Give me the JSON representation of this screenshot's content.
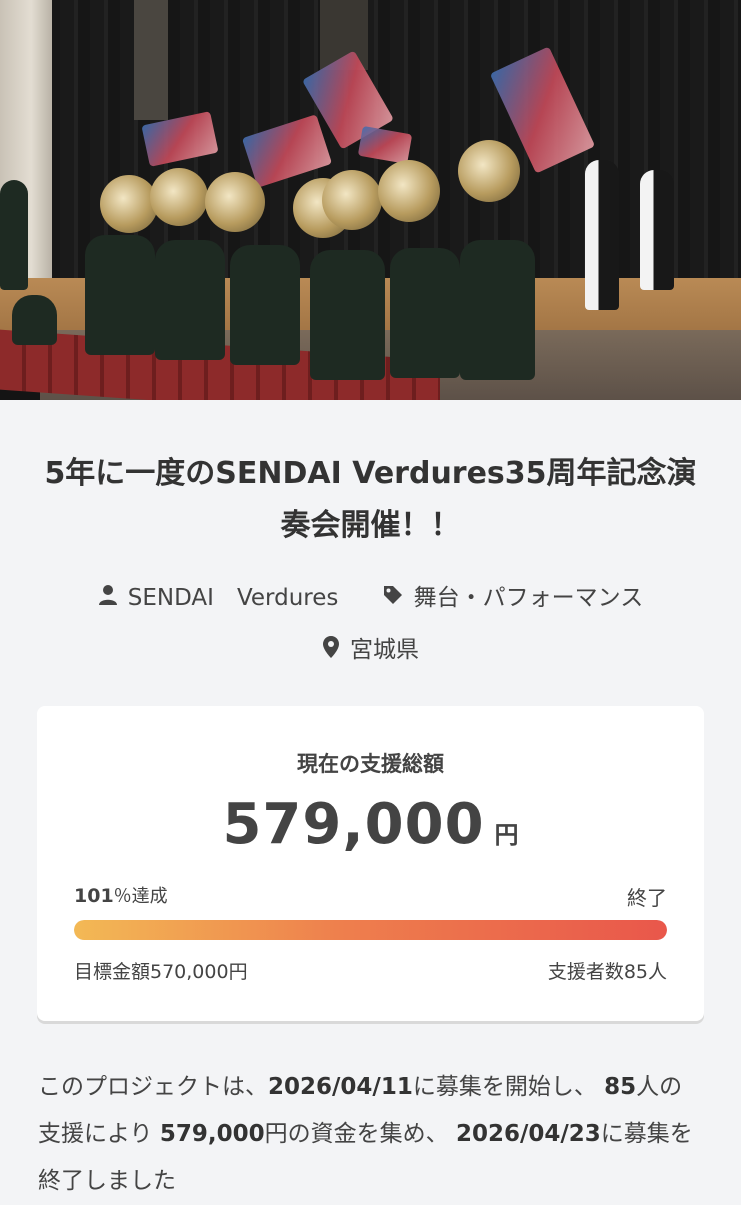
{
  "project": {
    "title": "5年に一度のSENDAI Verdures35周年記念演奏会開催！！",
    "owner": "SENDAI　Verdures",
    "category": "舞台・パフォーマンス",
    "location": "宮城県",
    "icons": {
      "owner": "person-icon",
      "category": "tag-icon",
      "location": "location-pin-icon"
    }
  },
  "support": {
    "label": "現在の支援総額",
    "amount": "579,000",
    "currency": "円",
    "rate_value": "101",
    "rate_suffix": "％達成",
    "status": "終了",
    "progress_percent": 101,
    "goal": "目標金額570,000円",
    "backers": "支援者数85人",
    "colors": {
      "bar_start": "#f3b955",
      "bar_end": "#e9574b"
    }
  },
  "description": {
    "p1": "このプロジェクトは、",
    "start_date": "2026/04/11",
    "p2": "に募集を開始し、 ",
    "backer_count": "85",
    "p3": "人の支援により ",
    "amount": "579,000",
    "p4": "円の資金を集め、 ",
    "end_date": "2026/04/23",
    "p5": "に募集を終了しました"
  }
}
